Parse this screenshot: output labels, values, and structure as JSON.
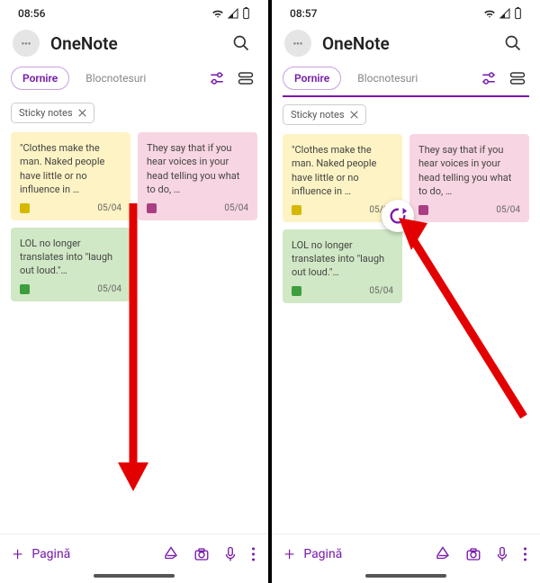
{
  "panes": [
    {
      "time": "08:56"
    },
    {
      "time": "08:57"
    }
  ],
  "app": {
    "title": "OneNote",
    "tabs": [
      {
        "label": "Pornire",
        "active": true
      },
      {
        "label": "Blocnotesuri",
        "active": false
      }
    ],
    "chip": "Sticky notes",
    "pagina": "Pagină"
  },
  "notes": [
    {
      "text": "\"Clothes make the man. Naked people have little or no influence in …",
      "date": "05/04",
      "color": "yellow"
    },
    {
      "text": "They say that if you hear voices in your head telling you what to do, …",
      "date": "05/04",
      "color": "pink"
    },
    {
      "text": "LOL no longer translates into \"laugh out loud.\"…",
      "date": "05/04",
      "color": "green"
    }
  ]
}
